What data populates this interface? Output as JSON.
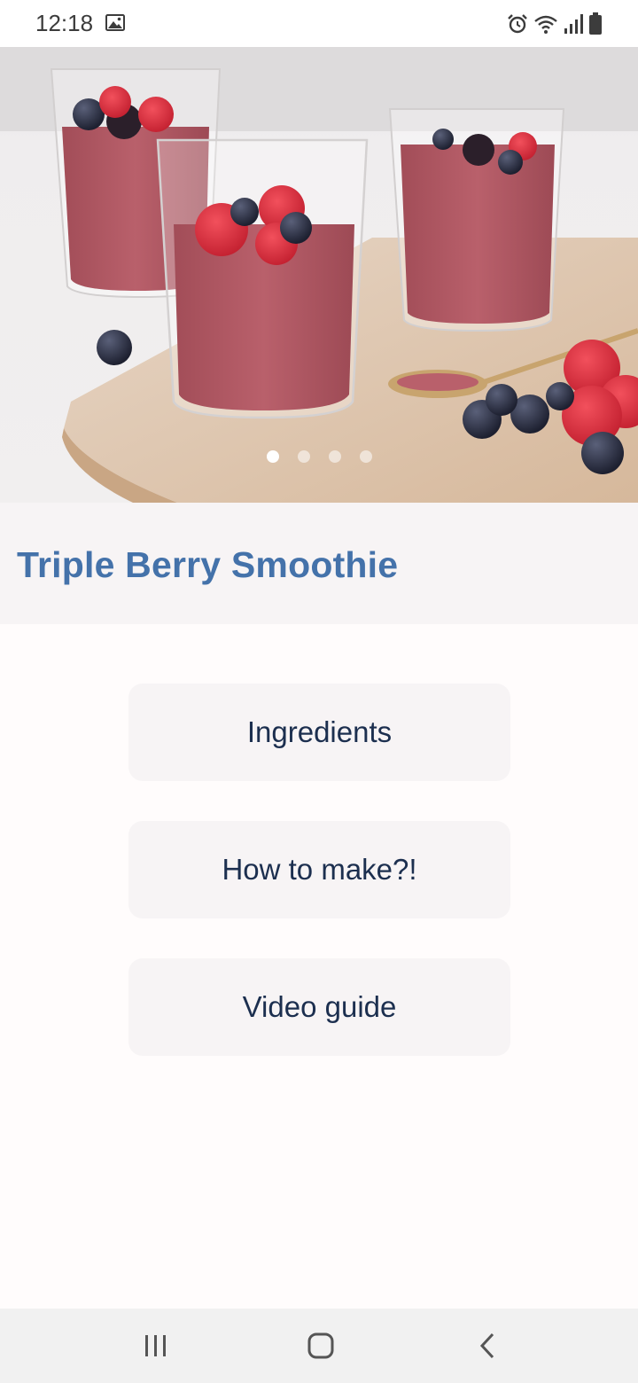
{
  "status_bar": {
    "time": "12:18",
    "icons": [
      "gallery-icon",
      "alarm-icon",
      "wifi-icon",
      "signal-icon",
      "battery-icon"
    ]
  },
  "hero": {
    "image_subject": "three glasses of berry smoothie with raspberries and blueberries on a wooden board",
    "carousel": {
      "pages": 4,
      "active_index": 0
    }
  },
  "recipe": {
    "title": "Triple Berry Smoothie"
  },
  "menu": {
    "ingredients_label": "Ingredients",
    "how_to_label": "How to make?!",
    "video_label": "Video guide"
  },
  "nav": {
    "icons": [
      "recents-icon",
      "home-icon",
      "back-icon"
    ]
  },
  "colors": {
    "title": "#4472aa",
    "button_bg": "#f7f4f5",
    "button_text": "#1c2f4f",
    "page_bg": "#fffcfc",
    "nav_bg": "#f1f1f1"
  }
}
